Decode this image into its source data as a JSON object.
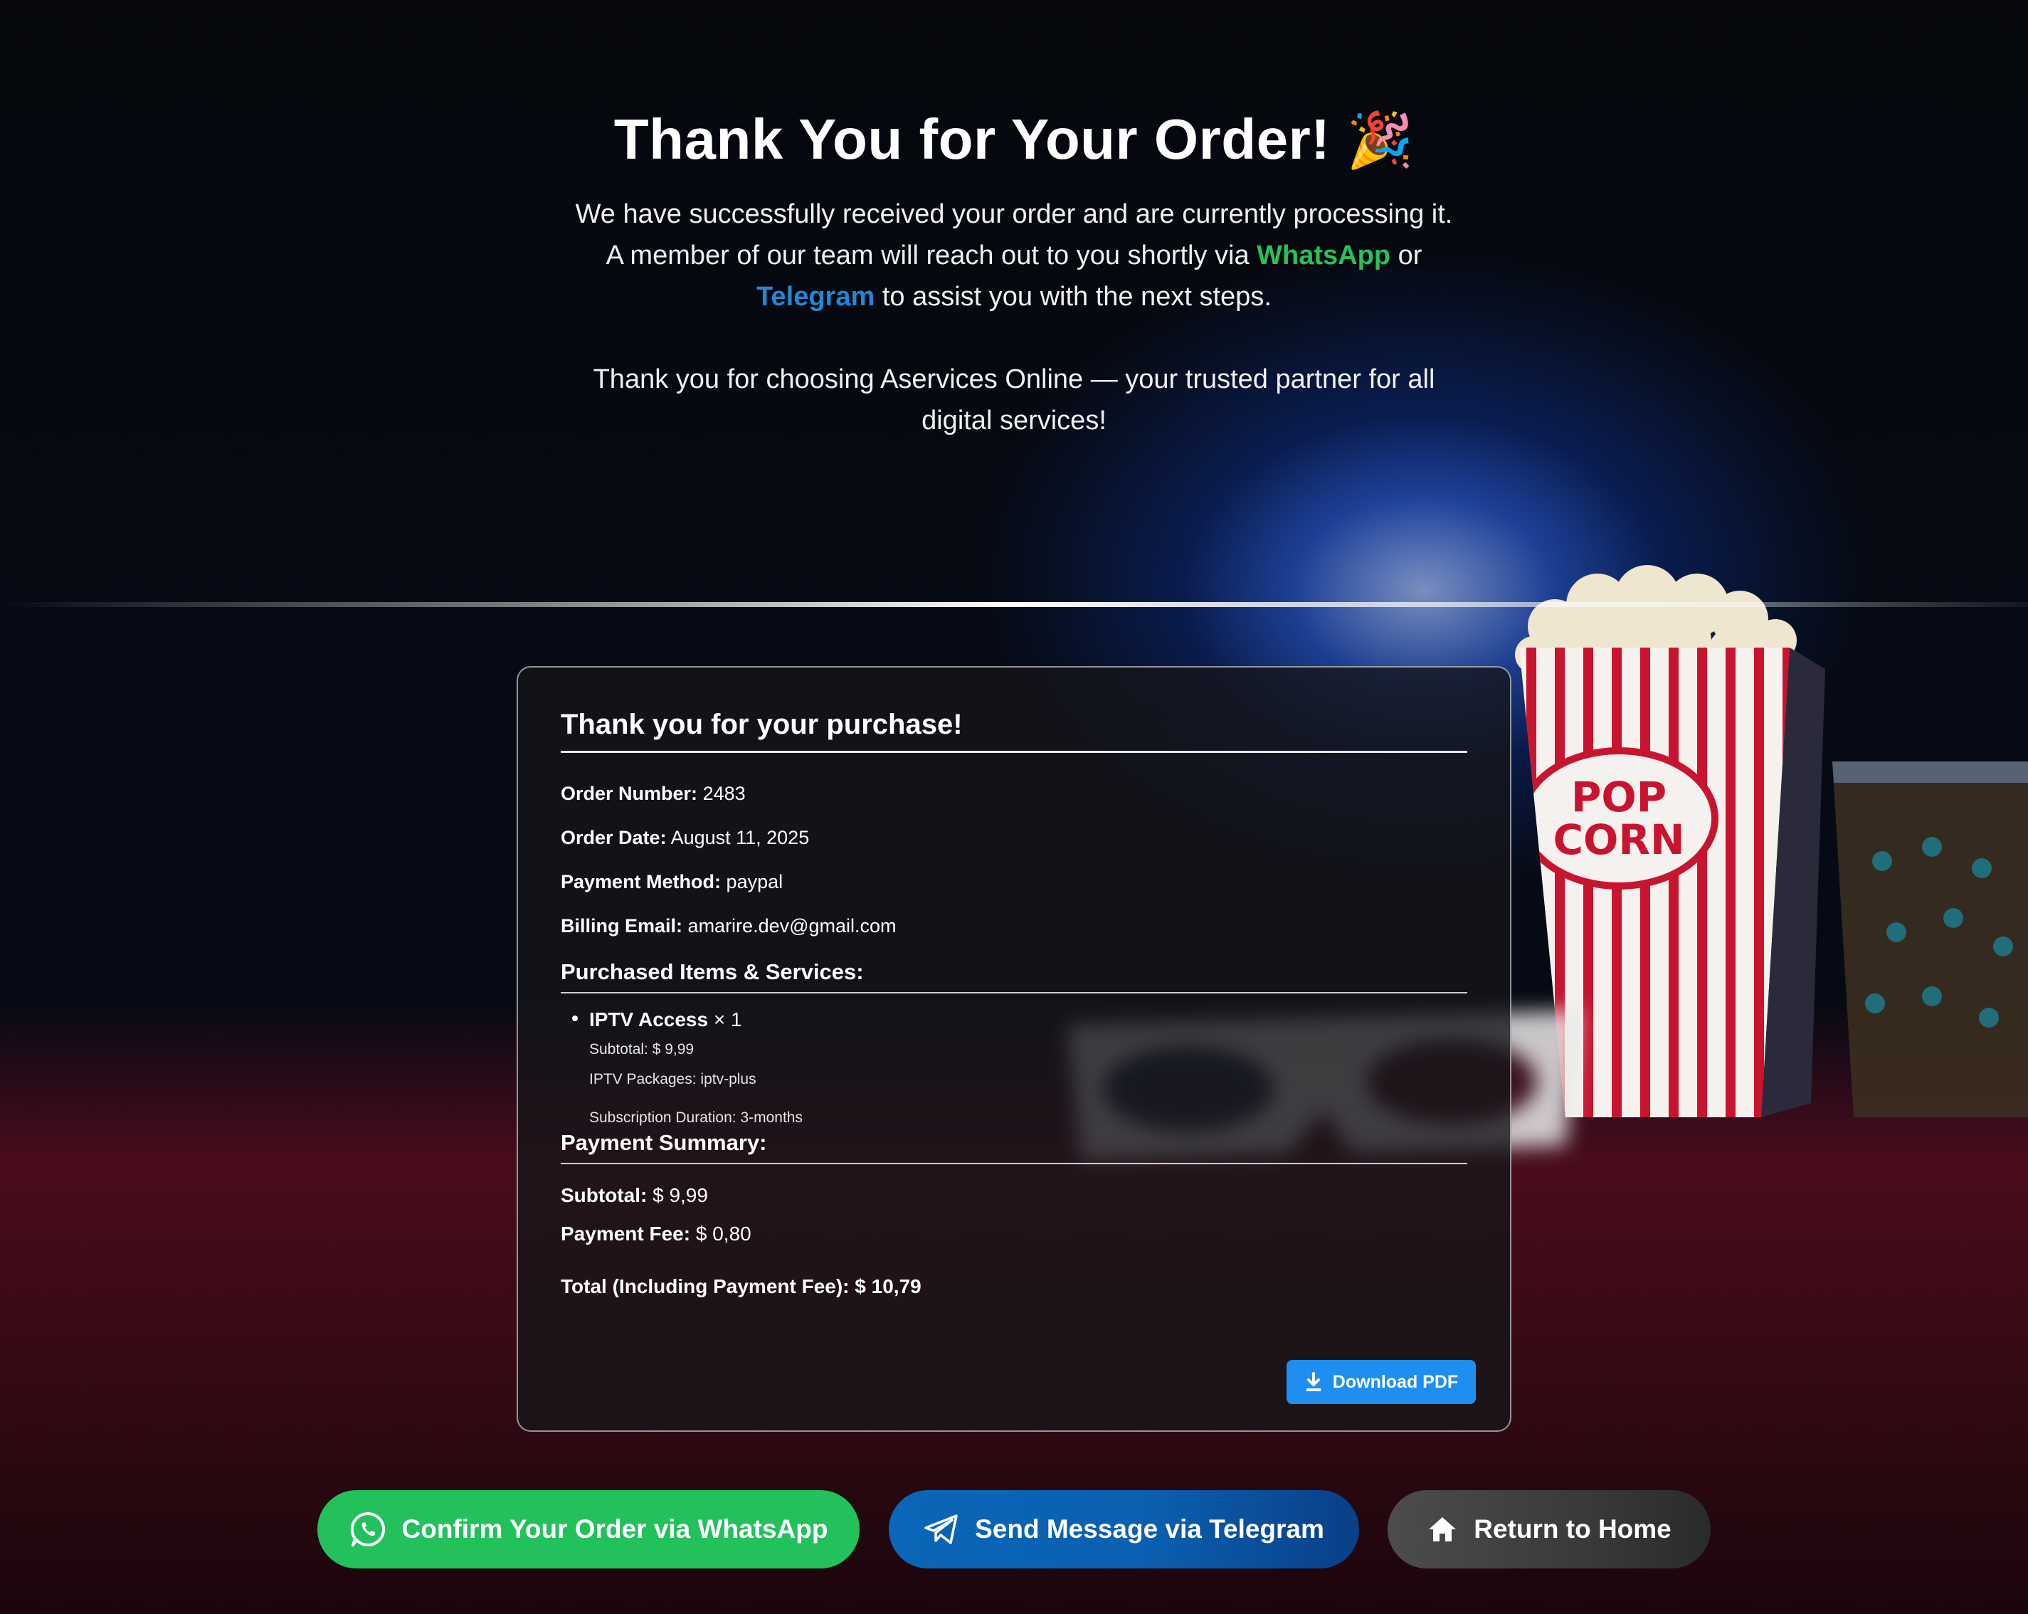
{
  "hero": {
    "title": "Thank You for Your Order!",
    "title_emoji": "🎉",
    "line1": "We have successfully received your order and are currently processing it.",
    "line2_pre": "A member of our team will reach out to you shortly via ",
    "whatsapp_word": "WhatsApp",
    "line2_mid": " or ",
    "telegram_word": "Telegram",
    "line2_post": " to assist you with the next steps.",
    "line3": "Thank you for choosing Aservices Online — your trusted partner for all digital services!"
  },
  "card": {
    "heading": "Thank you for your purchase!",
    "order_number_label": "Order Number:",
    "order_number": "2483",
    "order_date_label": "Order Date:",
    "order_date": "August 11, 2025",
    "payment_method_label": "Payment Method:",
    "payment_method": "paypal",
    "billing_email_label": "Billing Email:",
    "billing_email": "amarire.dev@gmail.com",
    "items_heading": "Purchased Items & Services:",
    "items": [
      {
        "name": "IPTV Access",
        "qty": "× 1",
        "subtotal": "Subtotal: $ 9,99",
        "packages": "IPTV Packages: iptv-plus",
        "duration": "Subscription Duration: 3-months"
      }
    ],
    "summary_heading": "Payment Summary:",
    "subtotal_label": "Subtotal:",
    "subtotal": "$ 9,99",
    "fee_label": "Payment Fee:",
    "fee": "$ 0,80",
    "total_label": "Total (Including Payment Fee):",
    "total": "$ 10,79",
    "download_label": "Download PDF"
  },
  "actions": {
    "whatsapp": "Confirm Your Order via WhatsApp",
    "telegram": "Send Message via Telegram",
    "home": "Return to Home"
  },
  "colors": {
    "whatsapp_green": "#22c15c",
    "telegram_blue": "#0a66b8",
    "pdf_blue": "#1e8ff0",
    "home_gray": "#3a3a3a"
  },
  "icons": {
    "confetti": "party-popper-icon",
    "download": "download-icon",
    "whatsapp": "whatsapp-icon",
    "telegram": "telegram-icon",
    "home": "home-icon"
  }
}
